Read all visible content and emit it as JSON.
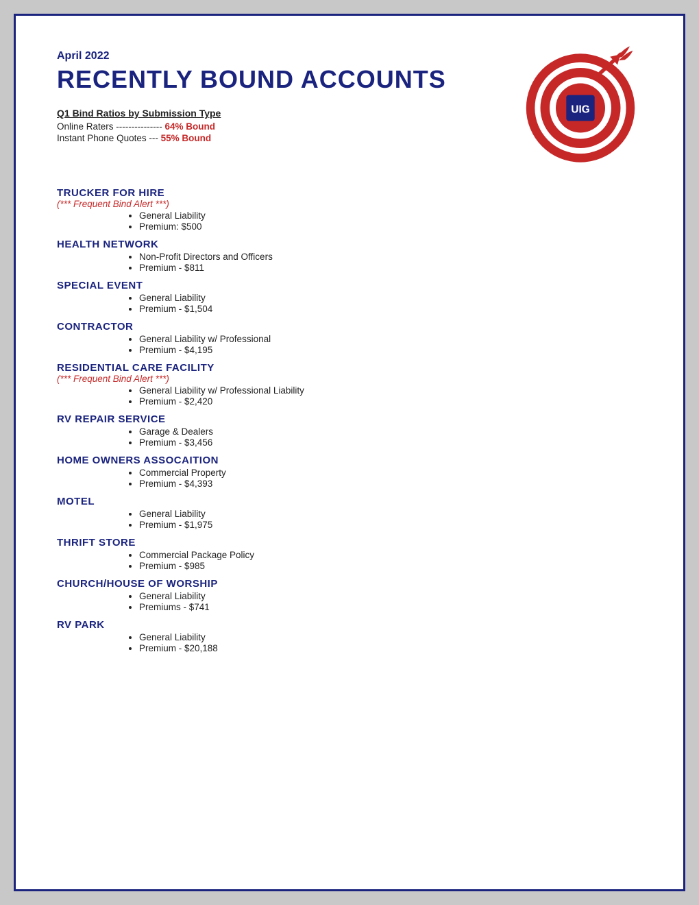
{
  "header": {
    "month_year": "April 2022",
    "title": "RECENTLY BOUND ACCOUNTS",
    "bind_ratios_title": "Q1 Bind Ratios by Submission Type",
    "bind_ratios": [
      {
        "label": "Online Raters --------------- ",
        "highlight": "64% Bound"
      },
      {
        "label": "Instant Phone Quotes --- ",
        "highlight": "55% Bound"
      }
    ]
  },
  "accounts": [
    {
      "name": "TRUCKER FOR HIRE",
      "alert": "(*** Frequent Bind Alert ***)",
      "details": [
        "General Liability",
        "Premium: $500"
      ]
    },
    {
      "name": "HEALTH NETWORK",
      "alert": null,
      "details": [
        "Non-Profit Directors and Officers",
        "Premium - $811"
      ]
    },
    {
      "name": "SPECIAL EVENT",
      "alert": null,
      "details": [
        "General Liability",
        "Premium - $1,504"
      ]
    },
    {
      "name": "CONTRACTOR",
      "alert": null,
      "details": [
        "General Liability w/ Professional",
        "Premium - $4,195"
      ]
    },
    {
      "name": "RESIDENTIAL CARE FACILITY",
      "alert": "(*** Frequent Bind Alert ***)",
      "details": [
        "General Liability w/ Professional Liability",
        "Premium - $2,420"
      ]
    },
    {
      "name": "RV REPAIR SERVICE",
      "alert": null,
      "details": [
        "Garage & Dealers",
        "Premium - $3,456"
      ]
    },
    {
      "name": "HOME OWNERS ASSOCAITION",
      "alert": null,
      "details": [
        "Commercial Property",
        "Premium - $4,393"
      ]
    },
    {
      "name": "MOTEL",
      "alert": null,
      "details": [
        "General Liability",
        "Premium - $1,975"
      ]
    },
    {
      "name": "THRIFT STORE",
      "alert": null,
      "details": [
        "Commercial Package Policy",
        "Premium - $985"
      ]
    },
    {
      "name": "CHURCH/HOUSE OF WORSHIP",
      "alert": null,
      "details": [
        "General Liability",
        "Premiums - $741"
      ]
    },
    {
      "name": "RV PARK",
      "alert": null,
      "details": [
        "General Liability",
        "Premium - $20,188"
      ]
    }
  ]
}
